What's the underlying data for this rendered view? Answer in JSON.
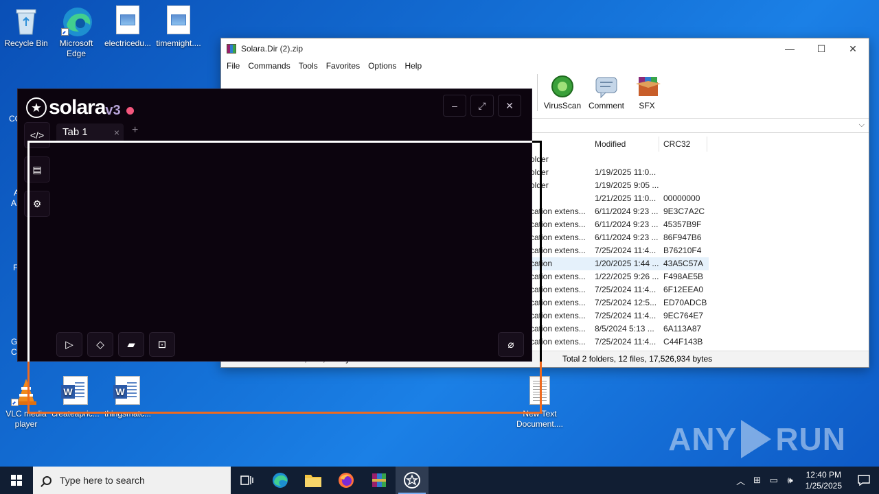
{
  "desktop": {
    "icons": [
      {
        "label": "Recycle Bin"
      },
      {
        "label": "Microsoft Edge"
      },
      {
        "label": "electricedu..."
      },
      {
        "label": "timemight...."
      },
      {
        "label": "VLC media player"
      },
      {
        "label": "createapric..."
      },
      {
        "label": "thingsmatc..."
      },
      {
        "label": "New Text Document...."
      }
    ],
    "partial_labels": [
      "CC",
      "A",
      "A",
      "F",
      "G",
      "C"
    ]
  },
  "winrar": {
    "title": "Solara.Dir (2).zip",
    "menu": [
      "File",
      "Commands",
      "Tools",
      "Favorites",
      "Options",
      "Help"
    ],
    "toolbar": [
      {
        "label": "VirusScan",
        "icon": "virus-scan-icon"
      },
      {
        "label": "Comment",
        "icon": "comment-icon"
      },
      {
        "label": "SFX",
        "icon": "sfx-icon"
      }
    ],
    "columns": [
      "Modified",
      "CRC32"
    ],
    "rows": [
      {
        "type": "older",
        "modified": "",
        "crc": ""
      },
      {
        "type": "older",
        "modified": "1/19/2025 11:0...",
        "crc": ""
      },
      {
        "type": "older",
        "modified": "1/19/2025 9:05 ...",
        "crc": ""
      },
      {
        "type": "",
        "modified": "1/21/2025 11:0...",
        "crc": "00000000"
      },
      {
        "type": "cation extens...",
        "modified": "6/11/2024 9:23 ...",
        "crc": "9E3C7A2C"
      },
      {
        "type": "cation extens...",
        "modified": "6/11/2024 9:23 ...",
        "crc": "45357B9F"
      },
      {
        "type": "cation extens...",
        "modified": "6/11/2024 9:23 ...",
        "crc": "86F947B6"
      },
      {
        "type": "cation extens...",
        "modified": "7/25/2024 11:4...",
        "crc": "B76210F4"
      },
      {
        "type": "cation",
        "modified": "1/20/2025 1:44 ...",
        "crc": "43A5C57A"
      },
      {
        "type": "cation extens...",
        "modified": "1/22/2025 9:26 ...",
        "crc": "F498AE5B"
      },
      {
        "type": "cation extens...",
        "modified": "7/25/2024 11:4...",
        "crc": "6F12EEA0"
      },
      {
        "type": "cation extens...",
        "modified": "7/25/2024 12:5...",
        "crc": "ED70ADCB"
      },
      {
        "type": "cation extens...",
        "modified": "7/25/2024 11:4...",
        "crc": "9EC764E7"
      },
      {
        "type": "cation extens...",
        "modified": "8/5/2024 5:13 ...",
        "crc": "6A113A87"
      },
      {
        "type": "cation extens...",
        "modified": "7/25/2024 11:4...",
        "crc": "C44F143B"
      }
    ],
    "status_left": "Selected 1 file, 620,224 bytes",
    "status_right": "Total 2 folders, 12 files, 17,526,934 bytes"
  },
  "solara": {
    "logo_word": "solara",
    "logo_version": "v3",
    "tab_label": "Tab 1",
    "tab_close": "×",
    "tab_add": "+",
    "window_controls": {
      "minimize": "–",
      "maximize": "⤢",
      "close": "✕"
    },
    "sidebar": [
      "code-icon",
      "script-list-icon",
      "settings-icon"
    ],
    "bottom_buttons": [
      "execute-icon",
      "clear-icon",
      "open-file-icon",
      "save-icon",
      "attach-icon"
    ]
  },
  "watermark": {
    "left": "ANY",
    "right": "RUN"
  },
  "taskbar": {
    "search_placeholder": "Type here to search",
    "time": "12:40 PM",
    "date": "1/25/2025"
  }
}
